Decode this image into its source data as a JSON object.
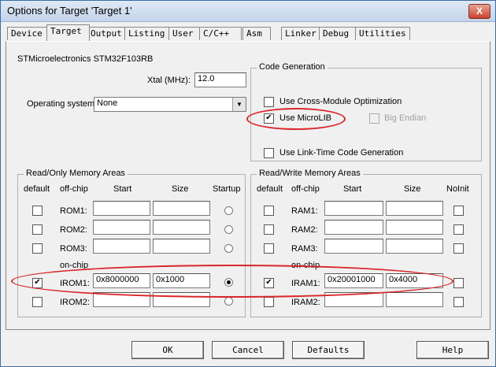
{
  "window": {
    "title": "Options for Target 'Target 1'",
    "close": "X"
  },
  "tabs": [
    "Device",
    "Target",
    "Output",
    "Listing",
    "User",
    "C/C++",
    "Asm",
    "Linker",
    "Debug",
    "Utilities"
  ],
  "device_name": "STMicroelectronics STM32F103RB",
  "xtal": {
    "label": "Xtal (MHz):",
    "value": "12.0"
  },
  "os": {
    "label": "Operating system:",
    "value": "None"
  },
  "codegen": {
    "title": "Code Generation",
    "cross_module": "Use Cross-Module Optimization",
    "microlib": "Use MicroLIB",
    "big_endian": "Big Endian",
    "link_time": "Use Link-Time Code Generation"
  },
  "rom": {
    "title": "Read/Only Memory Areas",
    "headers": {
      "default": "default",
      "offchip": "off-chip",
      "start": "Start",
      "size": "Size",
      "startup": "Startup"
    },
    "onchip": "on-chip",
    "rows": [
      {
        "name": "ROM1:",
        "start": "",
        "size": ""
      },
      {
        "name": "ROM2:",
        "start": "",
        "size": ""
      },
      {
        "name": "ROM3:",
        "start": "",
        "size": ""
      },
      {
        "name": "IROM1:",
        "start": "0x8000000",
        "size": "0x1000"
      },
      {
        "name": "IROM2:",
        "start": "",
        "size": ""
      }
    ]
  },
  "ram": {
    "title": "Read/Write Memory Areas",
    "headers": {
      "default": "default",
      "offchip": "off-chip",
      "start": "Start",
      "size": "Size",
      "noinit": "NoInit"
    },
    "onchip": "on-chip",
    "rows": [
      {
        "name": "RAM1:",
        "start": "",
        "size": ""
      },
      {
        "name": "RAM2:",
        "start": "",
        "size": ""
      },
      {
        "name": "RAM3:",
        "start": "",
        "size": ""
      },
      {
        "name": "IRAM1:",
        "start": "0x20001000",
        "size": "0x4000"
      },
      {
        "name": "IRAM2:",
        "start": "",
        "size": ""
      }
    ]
  },
  "buttons": {
    "ok": "OK",
    "cancel": "Cancel",
    "defaults": "Defaults",
    "help": "Help"
  },
  "check_mark": "✔",
  "highlight_color": "#d8262b"
}
